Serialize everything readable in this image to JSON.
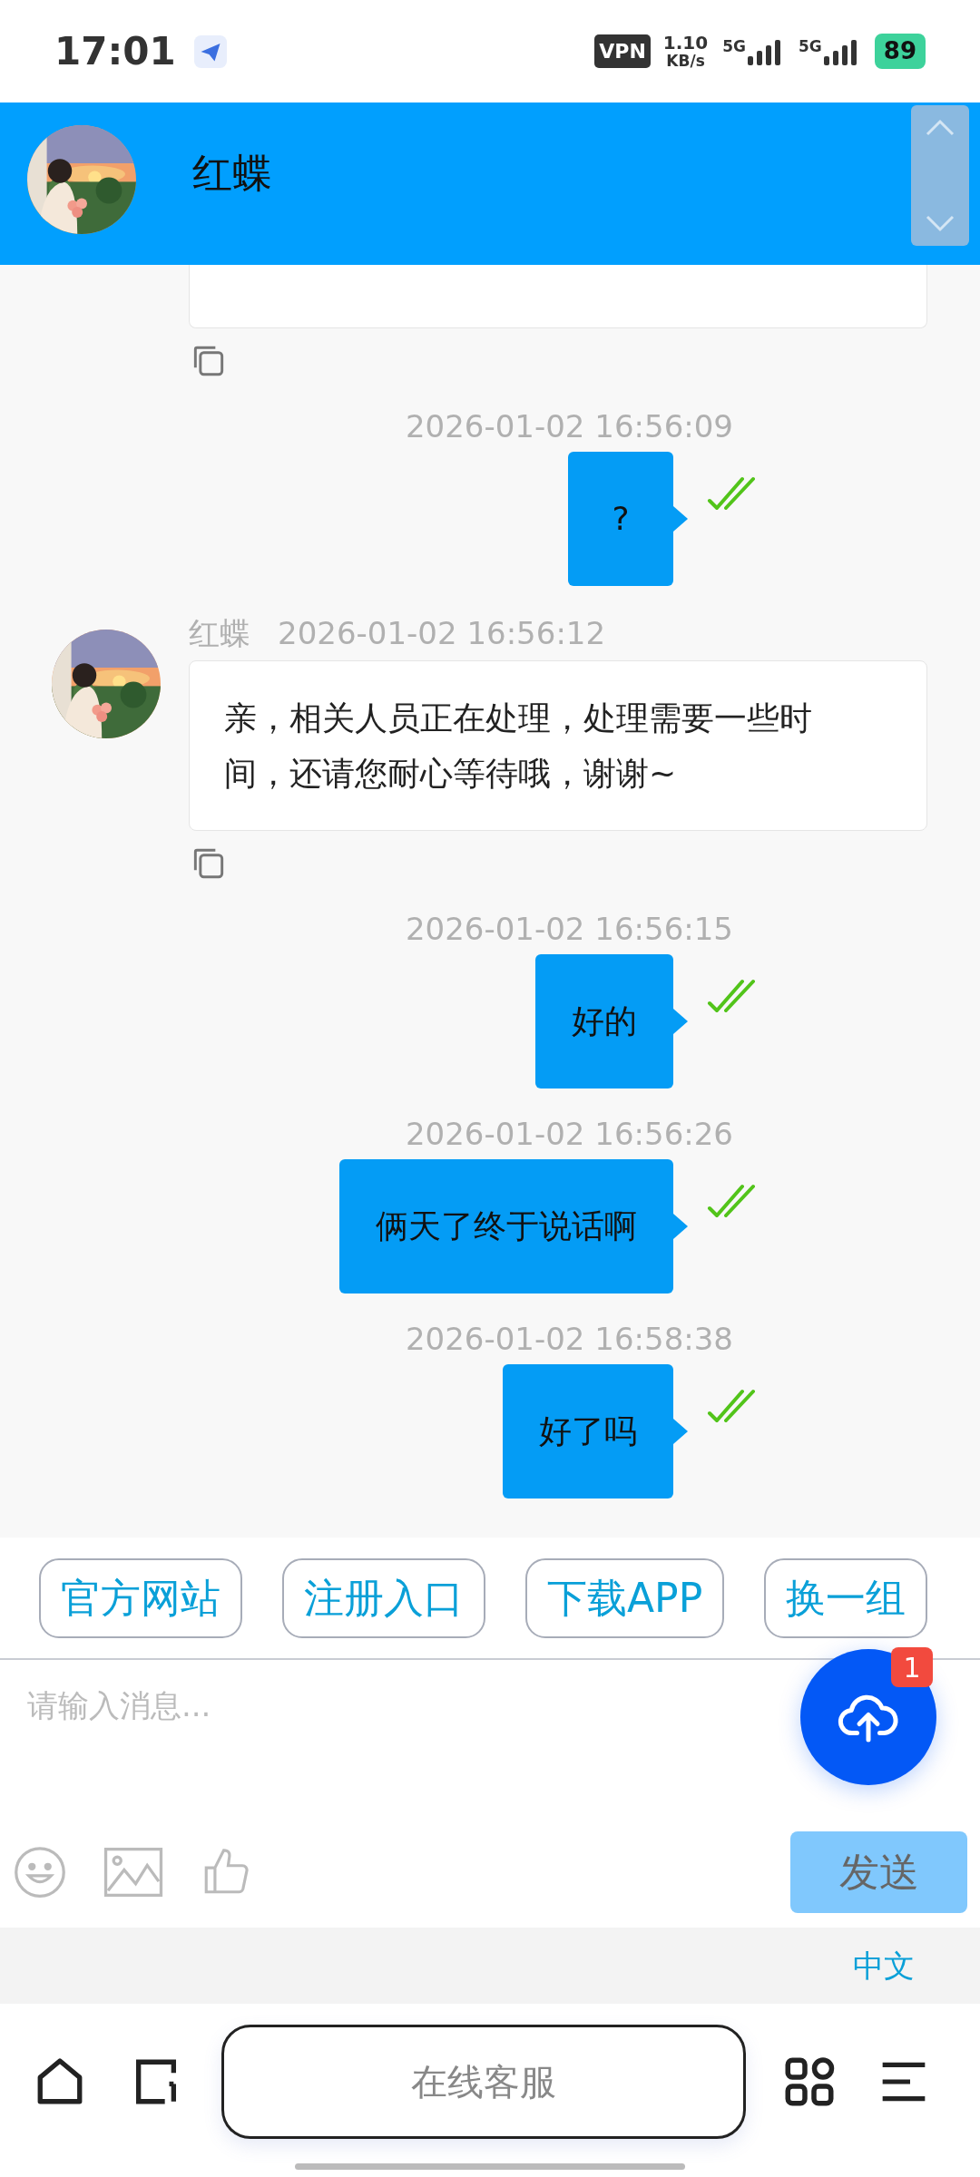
{
  "status_bar": {
    "time": "17:01",
    "vpn": "VPN",
    "speed_value": "1.10",
    "speed_unit": "KB/s",
    "sim1": "5G",
    "sim2": "5G",
    "battery": "89"
  },
  "header": {
    "name": "红蝶"
  },
  "messages": [
    {
      "kind": "received_partial"
    },
    {
      "kind": "sent",
      "time": "2026-01-02 16:56:09",
      "text": "?",
      "read": true
    },
    {
      "kind": "received",
      "name": "红蝶",
      "time": "2026-01-02 16:56:12",
      "text": "亲，相关人员正在处理，处理需要一些时间，还请您耐心等待哦，谢谢~"
    },
    {
      "kind": "sent",
      "time": "2026-01-02 16:56:15",
      "text": "好的",
      "read": true
    },
    {
      "kind": "sent",
      "time": "2026-01-02 16:56:26",
      "text": "俩天了终于说话啊",
      "read": true
    },
    {
      "kind": "sent",
      "time": "2026-01-02 16:58:38",
      "text": "好了吗",
      "read": true
    }
  ],
  "quick_replies": [
    "官方网站",
    "注册入口",
    "下载APP",
    "换一组"
  ],
  "upload_badge": "1",
  "composer": {
    "placeholder": "请输入消息...",
    "send": "发送",
    "send_disabled": true
  },
  "language": "中文",
  "bottom_nav": {
    "center": "在线客服"
  }
}
